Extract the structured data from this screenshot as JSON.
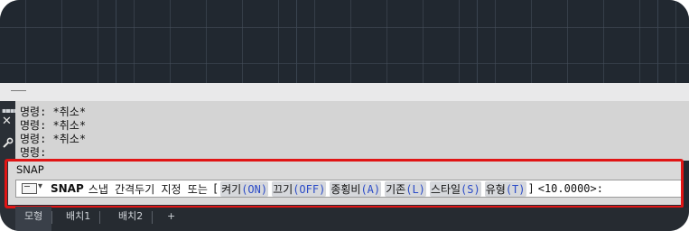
{
  "history": {
    "lines": [
      "명령: *취소*",
      "명령: *취소*",
      "명령: *취소*",
      "명령:"
    ]
  },
  "command": {
    "echo": "SNAP",
    "name": "SNAP",
    "prompt": "스냅 간격두기 지정 또는",
    "bracket_open": "[",
    "bracket_close": "]",
    "options": [
      {
        "label": "켜기",
        "key": "(ON)"
      },
      {
        "label": "끄기",
        "key": "(OFF)"
      },
      {
        "label": "종횡비",
        "key": "(A)"
      },
      {
        "label": "기존",
        "key": "(L)"
      },
      {
        "label": "스타일",
        "key": "(S)"
      },
      {
        "label": "유형",
        "key": "(T)"
      }
    ],
    "default_value": "<10.0000>:"
  },
  "tabs": [
    "모형",
    "배치1",
    "배치2",
    "+"
  ],
  "colors": {
    "highlight": "#e01515",
    "option_key": "#2b4bc7"
  }
}
